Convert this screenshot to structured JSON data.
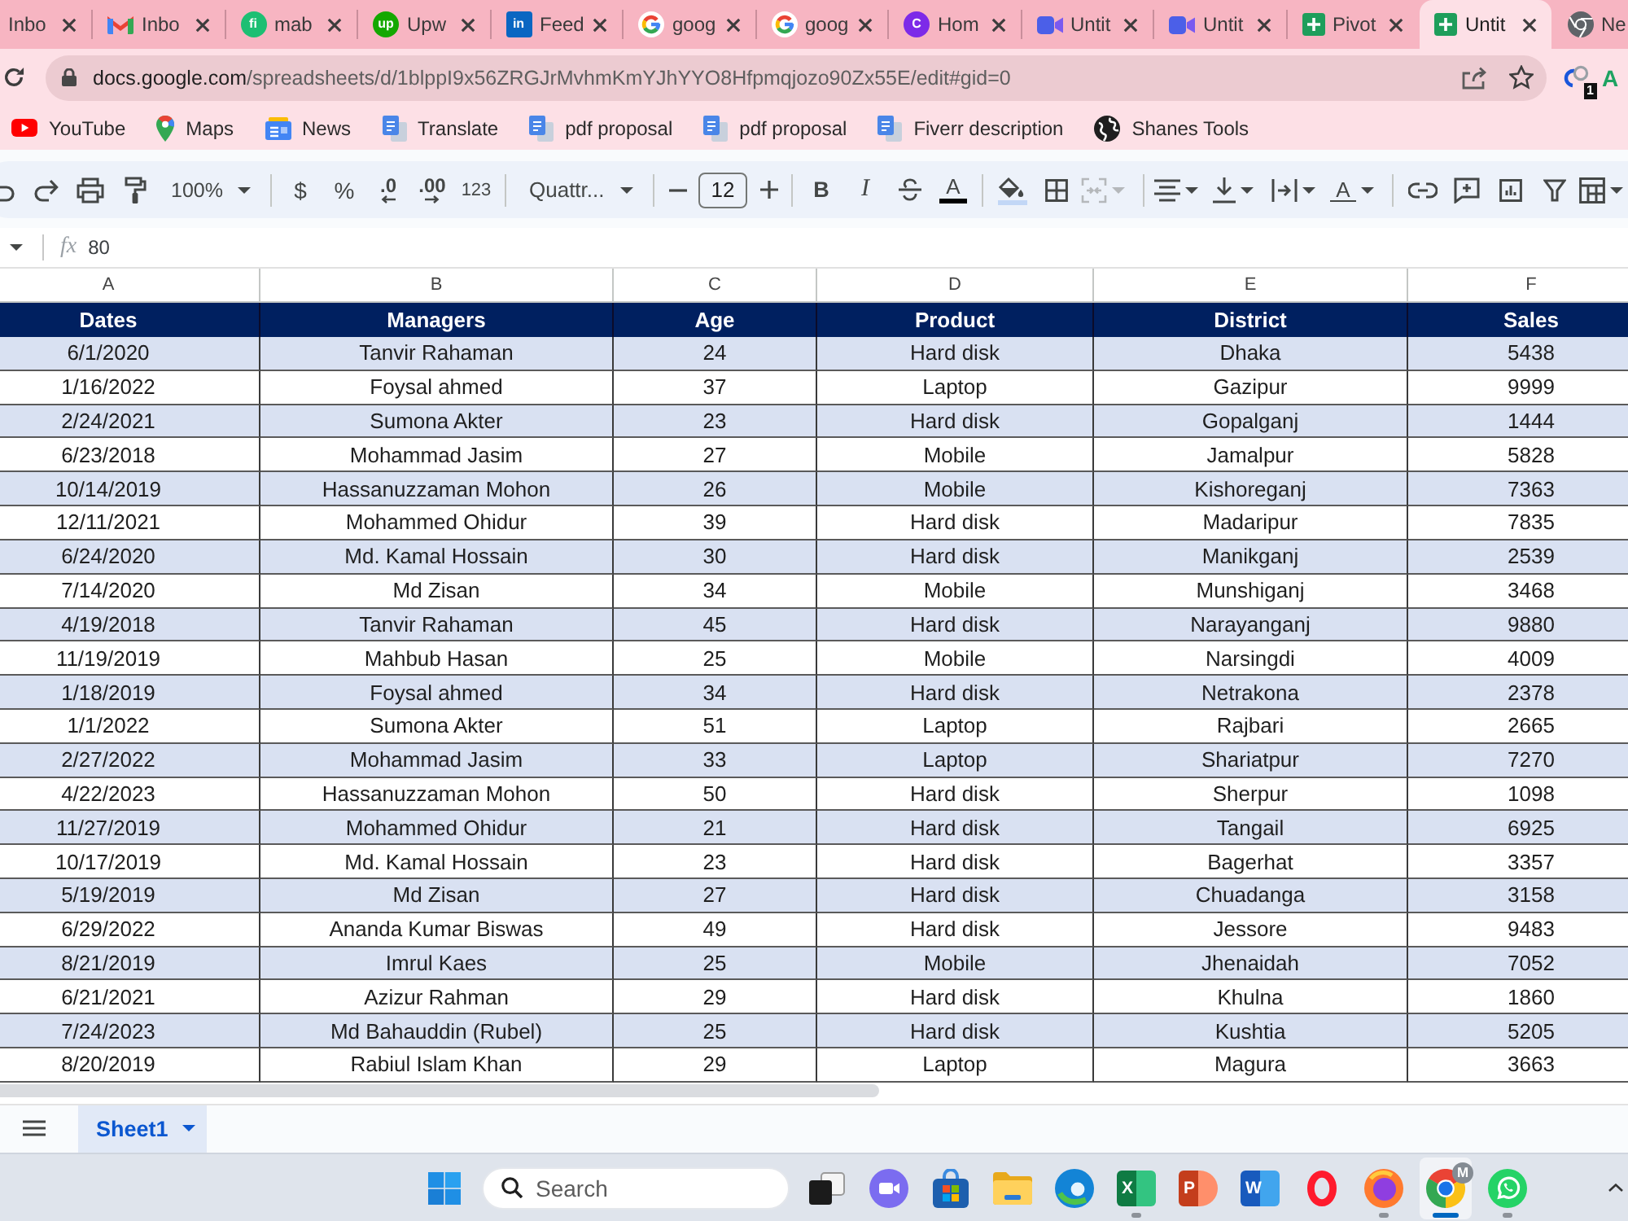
{
  "browser_tabs": [
    {
      "title": "Inbo",
      "selected": false
    },
    {
      "title": "Inbo",
      "kind": "mail",
      "selected": false
    },
    {
      "title": "mab",
      "kind": "letter",
      "glyph": "fi",
      "color": "#1dbf73",
      "selected": false
    },
    {
      "title": "Upw",
      "kind": "letter",
      "glyph": "up",
      "color": "#14a800",
      "selected": false
    },
    {
      "title": "Feed",
      "kind": "square",
      "glyph": "in",
      "color": "#0a66c2",
      "selected": false
    },
    {
      "title": "goog",
      "kind": "google",
      "selected": false
    },
    {
      "title": "goog",
      "kind": "google",
      "selected": false
    },
    {
      "title": "Hom",
      "kind": "letter",
      "glyph": "C",
      "color": "#7d2ae8",
      "selected": false
    },
    {
      "title": "Untit",
      "kind": "video",
      "selected": false
    },
    {
      "title": "Untit",
      "kind": "video",
      "selected": false
    },
    {
      "title": "Pivot",
      "kind": "sheet",
      "selected": false
    },
    {
      "title": "Untit",
      "kind": "sheet",
      "selected": true
    },
    {
      "title": "Ne",
      "kind": "chrome",
      "selected": false
    }
  ],
  "address_bar": {
    "host": "docs.google.com",
    "path": "/spreadsheets/d/1blppI9x56ZRGJrMvhmKmYJhYYO8Hfpmqjozo90Zx55E/edit#gid=0",
    "extension_badge": "1",
    "extension_letter": "A"
  },
  "bookmarks": [
    {
      "label": "YouTube",
      "kind": "play"
    },
    {
      "label": "Maps",
      "kind": "pin"
    },
    {
      "label": "News",
      "kind": "news"
    },
    {
      "label": "Translate",
      "kind": "doc"
    },
    {
      "label": "pdf proposal",
      "kind": "doc"
    },
    {
      "label": "pdf proposal",
      "kind": "doc"
    },
    {
      "label": "Fiverr description",
      "kind": "doc"
    },
    {
      "label": "Shanes Tools",
      "kind": "globe"
    }
  ],
  "toolbar": [
    {
      "kind": "undo",
      "disabled": false
    },
    {
      "kind": "redo",
      "disabled": false
    },
    {
      "kind": "print",
      "disabled": false
    },
    {
      "kind": "paint-format",
      "disabled": false
    },
    {
      "kind": "zoom",
      "value": "100%",
      "disabled": false
    },
    {
      "kind": "separator"
    },
    {
      "kind": "currency",
      "label": "$",
      "disabled": false
    },
    {
      "kind": "percent",
      "label": "%",
      "disabled": false
    },
    {
      "kind": "decimal-decrease",
      "label": ".0",
      "disabled": false
    },
    {
      "kind": "decimal-increase",
      "label": ".00",
      "disabled": false
    },
    {
      "kind": "number-format",
      "label": "123",
      "disabled": false
    },
    {
      "kind": "separator"
    },
    {
      "kind": "font",
      "value": "Quattr...",
      "disabled": false
    },
    {
      "kind": "separator"
    },
    {
      "kind": "minus",
      "disabled": false
    },
    {
      "kind": "font-size",
      "value": "12",
      "disabled": false
    },
    {
      "kind": "plus",
      "disabled": false
    },
    {
      "kind": "separator"
    },
    {
      "kind": "bold",
      "label": "B",
      "disabled": false
    },
    {
      "kind": "italic",
      "label": "I",
      "disabled": false
    },
    {
      "kind": "strikethrough",
      "disabled": false
    },
    {
      "kind": "text-color",
      "label": "A",
      "disabled": false
    },
    {
      "kind": "separator"
    },
    {
      "kind": "fill-color",
      "disabled": false
    },
    {
      "kind": "borders",
      "disabled": false
    },
    {
      "kind": "merge",
      "disabled": true
    },
    {
      "kind": "separator"
    },
    {
      "kind": "align",
      "disabled": false
    },
    {
      "kind": "valign",
      "disabled": false
    },
    {
      "kind": "wrap",
      "disabled": false
    },
    {
      "kind": "rotate",
      "label": "A",
      "disabled": false
    },
    {
      "kind": "separator"
    },
    {
      "kind": "link",
      "disabled": false
    },
    {
      "kind": "comment",
      "disabled": false
    },
    {
      "kind": "chart",
      "disabled": false
    },
    {
      "kind": "filter",
      "disabled": false
    },
    {
      "kind": "table",
      "disabled": false
    }
  ],
  "formula_bar": {
    "label": "fx",
    "value": "80"
  },
  "sheet": {
    "columns": [
      {
        "letter": "A",
        "heading": "Dates"
      },
      {
        "letter": "B",
        "heading": "Managers"
      },
      {
        "letter": "C",
        "heading": "Age"
      },
      {
        "letter": "D",
        "heading": "Product"
      },
      {
        "letter": "E",
        "heading": "District"
      },
      {
        "letter": "F",
        "heading": "Sales"
      }
    ],
    "rows": [
      [
        "6/1/2020",
        "Tanvir Rahaman",
        "24",
        "Hard disk",
        "Dhaka",
        "5438"
      ],
      [
        "1/16/2022",
        "Foysal ahmed",
        "37",
        "Laptop",
        "Gazipur",
        "9999"
      ],
      [
        "2/24/2021",
        "Sumona Akter",
        "23",
        "Hard disk",
        "Gopalganj",
        "1444"
      ],
      [
        "6/23/2018",
        "Mohammad Jasim",
        "27",
        "Mobile",
        "Jamalpur",
        "5828"
      ],
      [
        "10/14/2019",
        "Hassanuzzaman Mohon",
        "26",
        "Mobile",
        "Kishoreganj",
        "7363"
      ],
      [
        "12/11/2021",
        "Mohammed Ohidur",
        "39",
        "Hard disk",
        "Madaripur",
        "7835"
      ],
      [
        "6/24/2020",
        "Md. Kamal Hossain",
        "30",
        "Hard disk",
        "Manikganj",
        "2539"
      ],
      [
        "7/14/2020",
        "Md Zisan",
        "34",
        "Mobile",
        "Munshiganj",
        "3468"
      ],
      [
        "4/19/2018",
        "Tanvir Rahaman",
        "45",
        "Hard disk",
        "Narayanganj",
        "9880"
      ],
      [
        "11/19/2019",
        "Mahbub Hasan",
        "25",
        "Mobile",
        "Narsingdi",
        "4009"
      ],
      [
        "1/18/2019",
        "Foysal ahmed",
        "34",
        "Hard disk",
        "Netrakona",
        "2378"
      ],
      [
        "1/1/2022",
        "Sumona Akter",
        "51",
        "Laptop",
        "Rajbari",
        "2665"
      ],
      [
        "2/27/2022",
        "Mohammad Jasim",
        "33",
        "Laptop",
        "Shariatpur",
        "7270"
      ],
      [
        "4/22/2023",
        "Hassanuzzaman Mohon",
        "50",
        "Hard disk",
        "Sherpur",
        "1098"
      ],
      [
        "11/27/2019",
        "Mohammed Ohidur",
        "21",
        "Hard disk",
        "Tangail",
        "6925"
      ],
      [
        "10/17/2019",
        "Md. Kamal Hossain",
        "23",
        "Hard disk",
        "Bagerhat",
        "3357"
      ],
      [
        "5/19/2019",
        "Md Zisan",
        "27",
        "Hard disk",
        "Chuadanga",
        "3158"
      ],
      [
        "6/29/2022",
        "Ananda Kumar Biswas",
        "49",
        "Hard disk",
        "Jessore",
        "9483"
      ],
      [
        "8/21/2019",
        "Imrul Kaes",
        "25",
        "Mobile",
        "Jhenaidah",
        "7052"
      ],
      [
        "6/21/2021",
        "Azizur Rahman",
        "29",
        "Hard disk",
        "Khulna",
        "1860"
      ],
      [
        "7/24/2023",
        "Md Bahauddin (Rubel)",
        "25",
        "Hard disk",
        "Kushtia",
        "5205"
      ],
      [
        "8/20/2019",
        "Rabiul Islam Khan",
        "29",
        "Laptop",
        "Magura",
        "3663"
      ]
    ]
  },
  "sheet_tabs": [
    {
      "label": "Sheet1",
      "selected": true
    }
  ],
  "taskbar": {
    "search_placeholder": "Search",
    "apps": [
      {
        "kind": "task-view",
        "running": false,
        "selected": false
      },
      {
        "kind": "chat",
        "running": false,
        "selected": false
      },
      {
        "kind": "store",
        "running": false,
        "selected": false
      },
      {
        "kind": "folder",
        "running": false,
        "selected": false
      },
      {
        "kind": "edge",
        "running": false,
        "selected": false
      },
      {
        "kind": "excel",
        "glyph": "X",
        "running": true,
        "selected": false
      },
      {
        "kind": "powerpoint",
        "glyph": "P",
        "running": false,
        "selected": false
      },
      {
        "kind": "word",
        "glyph": "W",
        "running": false,
        "selected": false
      },
      {
        "kind": "opera",
        "running": false,
        "selected": false
      },
      {
        "kind": "firefox",
        "running": true,
        "selected": false
      },
      {
        "kind": "chrome",
        "badge": "M",
        "running": true,
        "selected": true
      },
      {
        "kind": "whatsapp",
        "running": true,
        "selected": false
      }
    ]
  }
}
